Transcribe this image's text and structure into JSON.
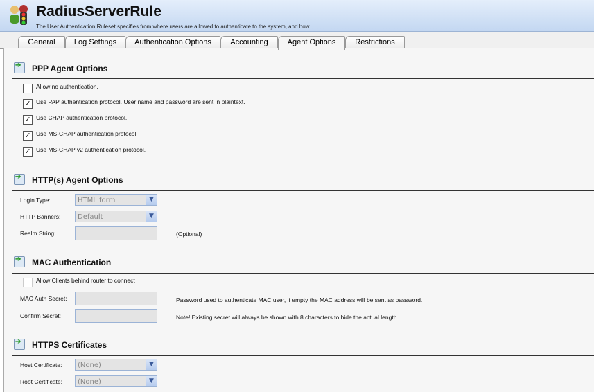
{
  "header": {
    "title": "RadiusServerRule",
    "subtitle": "The User Authentication Ruleset specifies from where users are allowed to authenticate to the system, and how."
  },
  "tabs": [
    {
      "label": "General"
    },
    {
      "label": "Log Settings"
    },
    {
      "label": "Authentication Options"
    },
    {
      "label": "Accounting"
    },
    {
      "label": "Agent Options",
      "active": true
    },
    {
      "label": "Restrictions"
    }
  ],
  "ppp": {
    "heading": "PPP Agent Options",
    "options": [
      {
        "label": "Allow no authentication.",
        "checked": false
      },
      {
        "label": "Use PAP authentication protocol. User name and password are sent in plaintext.",
        "checked": true
      },
      {
        "label": "Use CHAP authentication protocol.",
        "checked": true
      },
      {
        "label": "Use MS-CHAP authentication protocol.",
        "checked": true
      },
      {
        "label": "Use MS-CHAP v2 authentication protocol.",
        "checked": true
      }
    ]
  },
  "http": {
    "heading": "HTTP(s) Agent Options",
    "login_type_label": "Login Type:",
    "login_type_value": "HTML form",
    "banners_label": "HTTP Banners:",
    "banners_value": "Default",
    "realm_label": "Realm String:",
    "realm_value": "",
    "realm_hint": "(Optional)"
  },
  "mac": {
    "heading": "MAC Authentication",
    "allow_label": "Allow Clients behind router to connect",
    "secret_label": "MAC Auth Secret:",
    "secret_hint": "Password used to authenticate MAC user, if empty the MAC address will be sent as password.",
    "confirm_label": "Confirm Secret:",
    "confirm_hint": "Note! Existing secret will always be shown with 8 characters to hide the actual length."
  },
  "https": {
    "heading": "HTTPS Certificates",
    "host_label": "Host Certificate:",
    "host_value": "(None)",
    "root_label": "Root Certificate:",
    "root_value": "(None)"
  },
  "icons": {
    "check": "✓",
    "arrow": "▼"
  }
}
